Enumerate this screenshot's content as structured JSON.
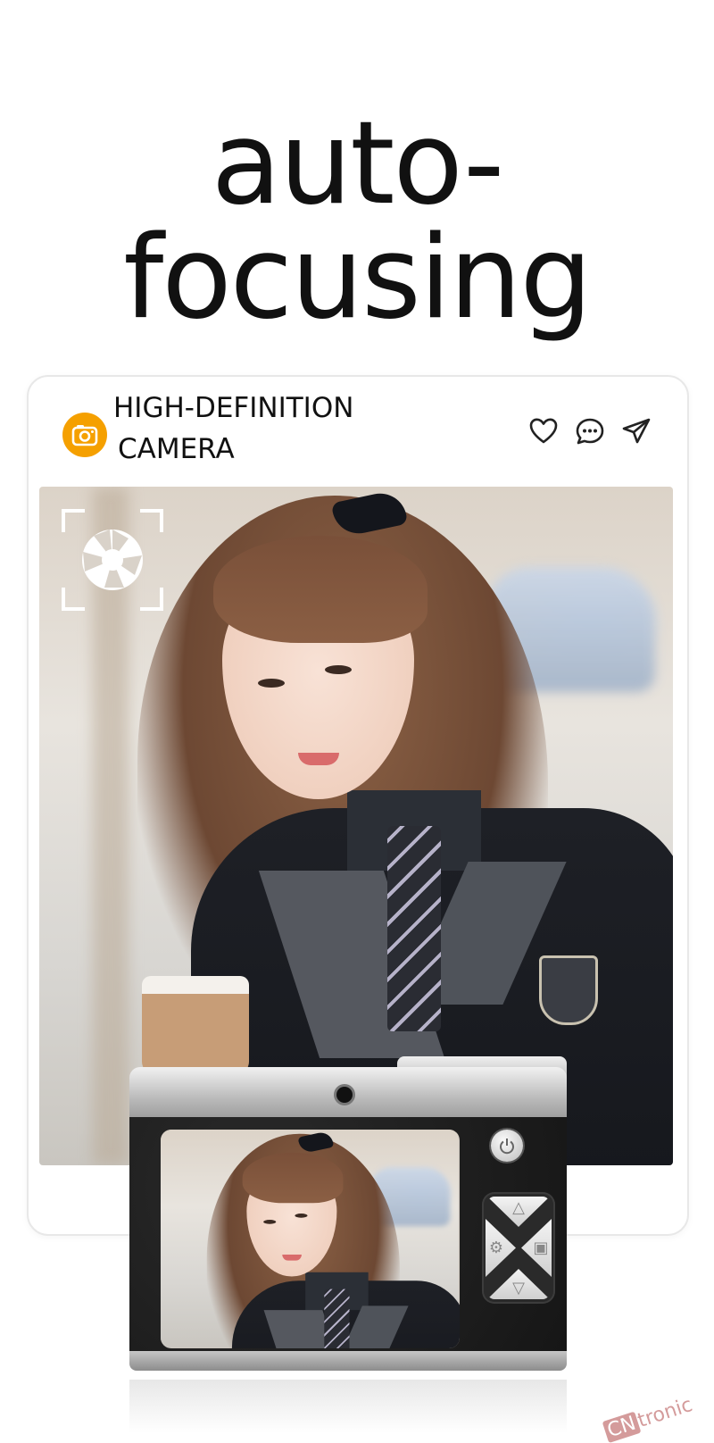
{
  "headline": "auto-focusing",
  "card": {
    "title_line1": "HIGH-DEFINITION",
    "title_line2": "CAMERA",
    "icons": [
      "camera-app-icon",
      "heart-icon",
      "comment-icon",
      "send-icon"
    ]
  },
  "photo": {
    "overlay_icon": "aperture-focus-icon"
  },
  "camera_device": {
    "buttons": [
      "power-icon",
      "up-arrow",
      "down-arrow",
      "left-arrow",
      "right-arrow"
    ]
  },
  "watermark": {
    "prefix": "CN",
    "text": "tronic"
  },
  "colors": {
    "accent": "#f5a000",
    "text": "#111111",
    "card_border": "#e8e8e8"
  }
}
